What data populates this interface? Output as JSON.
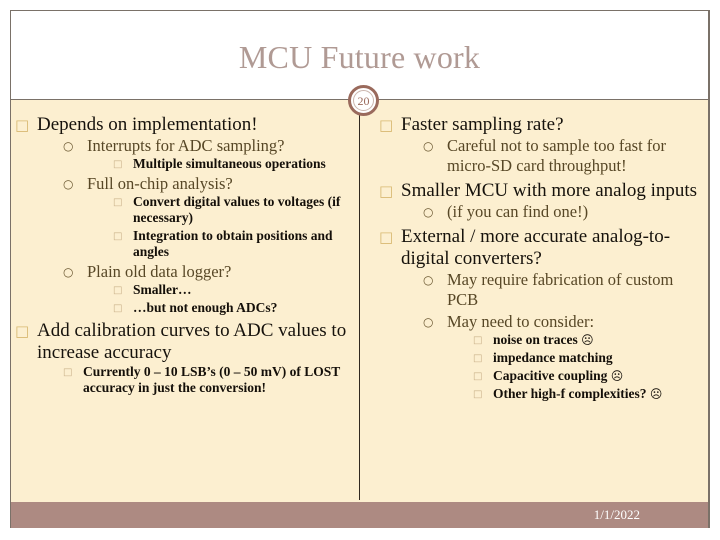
{
  "slide": {
    "title": "MCU Future work",
    "page_number": "20",
    "footer_date": "1/1/2022",
    "colors": {
      "title": "#b09a94",
      "body_background": "#fcefd0",
      "footer_bar": "#ad8a82",
      "frame_border": "#7a7168",
      "level1_bullet": "#d8b871",
      "level2_text": "#574726",
      "level3_text": "#140f09"
    }
  },
  "bullet_glyphs": {
    "level1": "□",
    "level2": "○",
    "level3": "□",
    "sad_face": "☹"
  },
  "left_column": [
    {
      "level": 1,
      "text": "Depends on implementation!",
      "children": [
        {
          "level": 2,
          "text": "Interrupts for ADC sampling?",
          "children": [
            {
              "level": 3,
              "text": "Multiple simultaneous operations"
            }
          ]
        },
        {
          "level": 2,
          "text": "Full on-chip analysis?",
          "children": [
            {
              "level": 3,
              "text": "Convert digital values to voltages (if necessary)"
            },
            {
              "level": 3,
              "text": "Integration to obtain positions and angles"
            }
          ]
        },
        {
          "level": 2,
          "text": "Plain old data logger?",
          "children": [
            {
              "level": 3,
              "text": "Smaller…"
            },
            {
              "level": 3,
              "text": "…but not enough ADCs?"
            }
          ]
        }
      ]
    },
    {
      "level": 1,
      "text": "Add calibration curves to ADC values to increase accuracy",
      "children": [
        {
          "level": 3,
          "text": "Currently 0 – 10 LSB’s (0 – 50 mV) of LOST accuracy in just the conversion!"
        }
      ]
    }
  ],
  "right_column": [
    {
      "level": 1,
      "text": "Faster sampling rate?",
      "children": [
        {
          "level": 2,
          "text": "Careful not to sample too fast for micro-SD card throughput!"
        }
      ]
    },
    {
      "level": 1,
      "text": "Smaller MCU with more analog inputs",
      "children": [
        {
          "level": 2,
          "text": "(if you can find one!)"
        }
      ]
    },
    {
      "level": 1,
      "text": "External / more accurate analog-to-digital converters?",
      "children": [
        {
          "level": 2,
          "text": "May require fabrication of custom PCB"
        },
        {
          "level": 2,
          "text": "May need to consider:",
          "children": [
            {
              "level": 3,
              "text": "noise on traces ☹"
            },
            {
              "level": 3,
              "text": "impedance matching"
            },
            {
              "level": 3,
              "text": "Capacitive coupling ☹"
            },
            {
              "level": 3,
              "text": "Other high-f complexities? ☹"
            }
          ]
        }
      ]
    }
  ]
}
